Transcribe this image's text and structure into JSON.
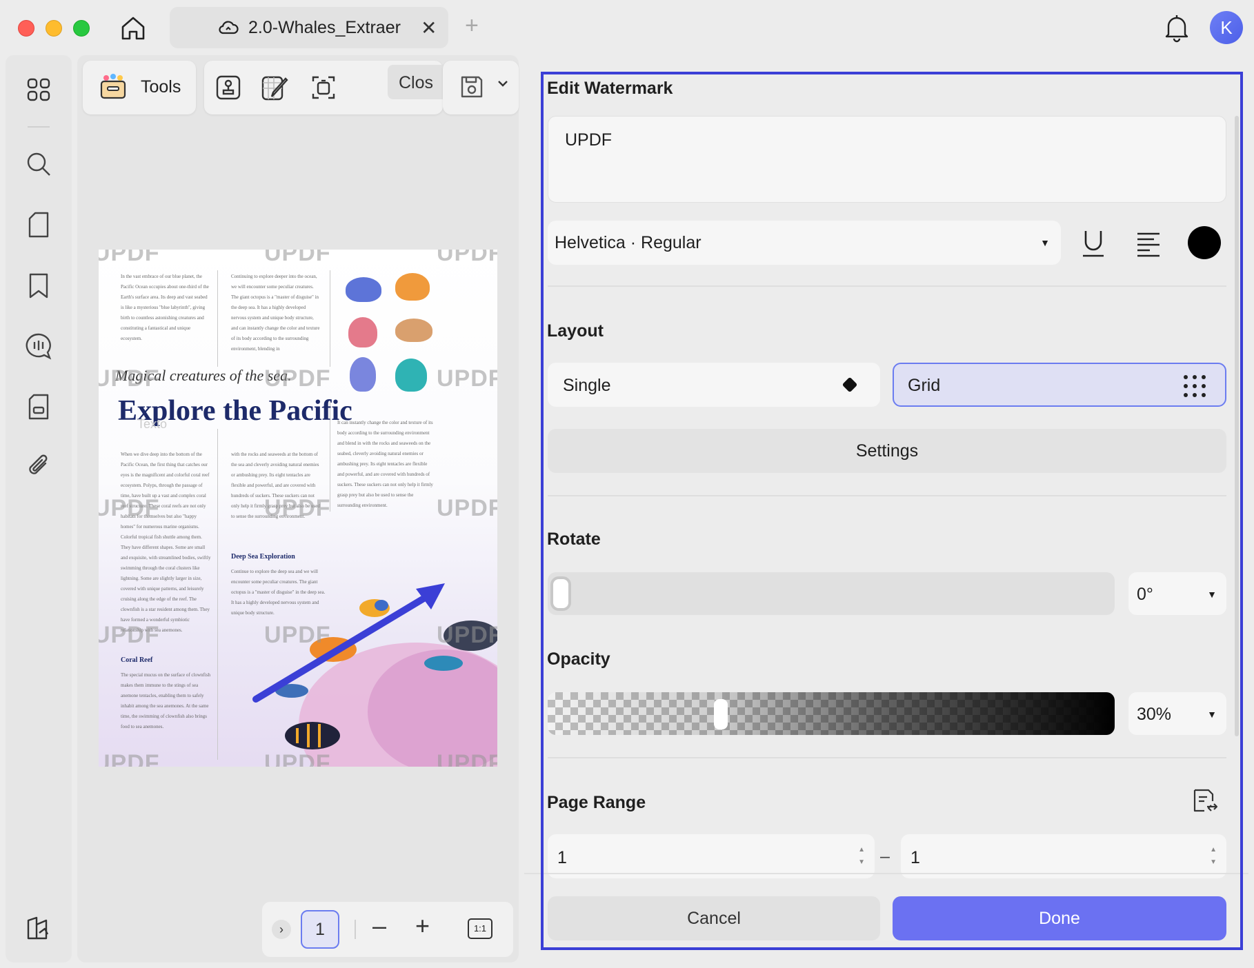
{
  "window": {
    "tab_title": "2.0-Whales_Extraer",
    "tab_close": "✕",
    "tab_add": "+",
    "avatar_initial": "K",
    "accent_color": "#6b71f2"
  },
  "toolbar": {
    "tools_label": "Tools",
    "close_label": "Clos"
  },
  "document": {
    "watermark_text": "UPDF",
    "subtitle": "Magical creatures of the sea.",
    "headline": "Explore the Pacific",
    "section_deep_sea": "Deep Sea Exploration",
    "section_coral": "Coral Reef",
    "faint_label": "Texto",
    "col1_top": "In the vast embrace of our blue planet, the Pacific Ocean occupies about one-third of the Earth's surface area. Its deep and vast seabed is like a mysterious \"blue labyrinth\", giving birth to countless astonishing creatures and constituting a fantastical and unique ecosystem.",
    "col2_top": "Continuing to explore deeper into the ocean, we will encounter some peculiar creatures. The giant octopus is a \"master of disguise\" in the deep sea. It has a highly developed nervous system and unique body structure, and can instantly change the color and texture of its body according to the surrounding environment, blending in",
    "col1_mid": "When we dive deep into the bottom of the Pacific Ocean, the first thing that catches our eyes is the magnificent and colorful coral reef ecosystem. Polyps, through the passage of time, have built up a vast and complex coral reef structure. These coral reefs are not only habitats for themselves but also \"happy homes\" for numerous marine organisms. Colorful tropical fish shuttle among them. They have different shapes. Some are small and exquisite, with streamlined bodies, swiftly swimming through the coral clusters like lightning. Some are slightly larger in size, covered with unique patterns, and leisurely cruising along the edge of the reef. The clownfish is a star resident among them. They have formed a wonderful symbiotic relationship with sea anemones.",
    "col2_mid": "with the rocks and seaweeds at the bottom of the sea and cleverly avoiding natural enemies or ambushing prey. Its eight tentacles are flexible and powerful, and are covered with hundreds of suckers. These suckers can not only help it firmly grasp prey but also be used to sense the surrounding environment.",
    "col3_mid": "It can instantly change the color and texture of its body according to the surrounding environment and blend in with the rocks and seaweeds on the seabed, cleverly avoiding natural enemies or ambushing prey. Its eight tentacles are flexible and powerful, and are covered with hundreds of suckers. These suckers can not only help it firmly grasp prey but also be used to sense the surrounding environment.",
    "col2_deep": "Continue to explore the deep sea and we will encounter some peculiar creatures. The giant octopus is a \"master of disguise\" in the deep sea. It has a highly developed nervous system and unique body structure.",
    "col1_coral": "The special mucus on the surface of clownfish makes them immune to the stings of sea anemone tentacles, enabling them to safely inhabit among the sea anemones. At the same time, the swimming of clownfish also brings food to sea anemones."
  },
  "pager": {
    "current_page": "1",
    "next": "›",
    "zoom_out": "–",
    "zoom_in": "+",
    "fit": "1:1"
  },
  "panel": {
    "title": "Edit Watermark",
    "text_value": "UPDF",
    "font": "Helvetica · Regular",
    "text_color": "#000000",
    "layout_title": "Layout",
    "layout_options": [
      "Single",
      "Grid"
    ],
    "layout_selected": "Grid",
    "settings_label": "Settings",
    "rotate_title": "Rotate",
    "rotate_value": "0°",
    "rotate_level": 0,
    "opacity_title": "Opacity",
    "opacity_value": "30%",
    "opacity_level": 0.3,
    "page_range_title": "Page Range",
    "range_from": "1",
    "range_to": "1",
    "range_dash": "–",
    "cancel_label": "Cancel",
    "done_label": "Done"
  }
}
